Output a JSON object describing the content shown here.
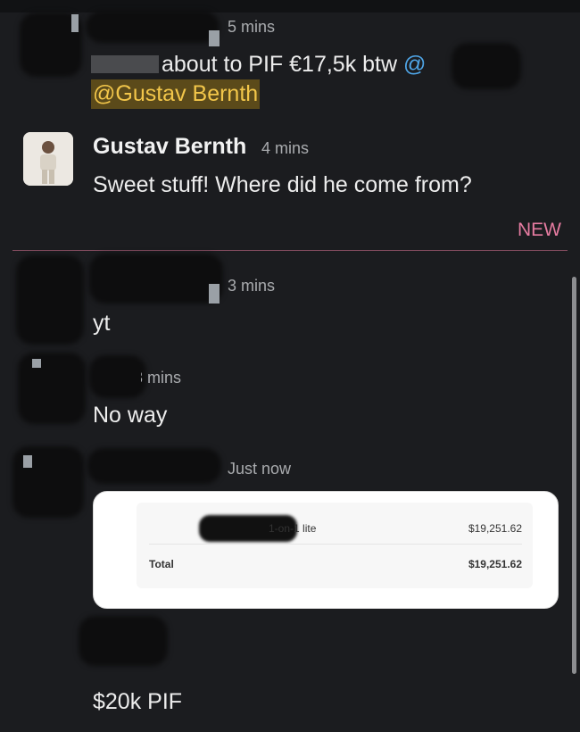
{
  "messages": [
    {
      "time": "5 mins",
      "text": "about to PIF €17,5k btw",
      "mention_at": "@",
      "mention": "@Gustav Bernth"
    },
    {
      "author": "Gustav Bernth",
      "time": "4 mins",
      "text": "Sweet stuff! Where did he come from?"
    },
    {
      "new_label": "NEW"
    },
    {
      "time": "3 mins",
      "text": "yt"
    },
    {
      "time": "3 mins",
      "text": "No way"
    },
    {
      "time": "Just now",
      "receipt": {
        "item_label": "1-on-1 lite",
        "item_amount": "$19,251.62",
        "total_label": "Total",
        "total_amount": "$19,251.62"
      }
    },
    {
      "text": "$20k PIF"
    }
  ]
}
